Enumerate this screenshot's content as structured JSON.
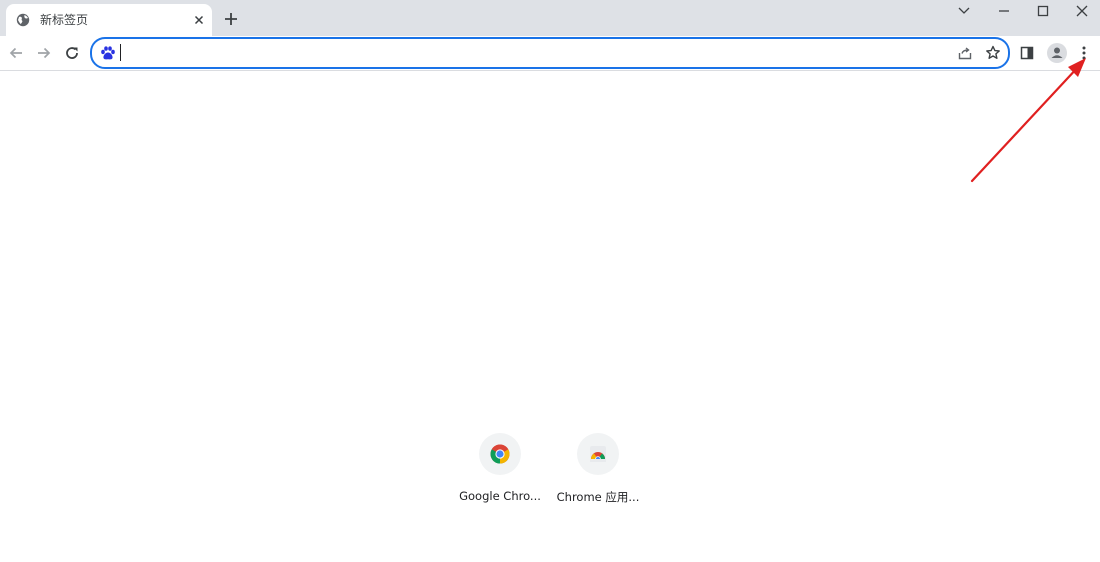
{
  "tab": {
    "title": "新标签页"
  },
  "omnibox": {
    "value": "",
    "placeholder": ""
  },
  "shortcuts": [
    {
      "label": "Google Chro..."
    },
    {
      "label": "Chrome 应用..."
    }
  ],
  "colors": {
    "accent": "#1a73e8",
    "annotation_arrow": "#e02020",
    "tabstrip": "#dee1e6"
  },
  "icons": [
    "globe-icon",
    "close-icon",
    "new-tab-icon",
    "chevron-down-icon",
    "minimize-icon",
    "maximize-icon",
    "window-close-icon",
    "back-icon",
    "forward-icon",
    "reload-icon",
    "baidu-icon",
    "share-icon",
    "star-icon",
    "side-panel-icon",
    "profile-icon",
    "menu-icon",
    "chrome-icon",
    "chrome-apps-icon"
  ]
}
